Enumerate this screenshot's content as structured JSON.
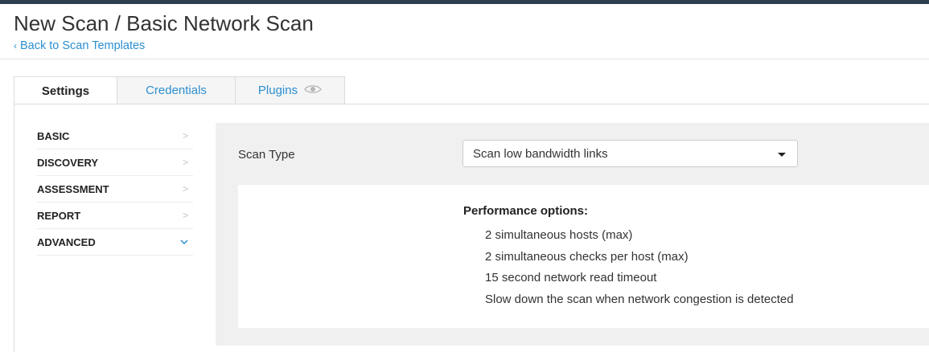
{
  "header": {
    "title": "New Scan / Basic Network Scan",
    "back_link": "Back to Scan Templates"
  },
  "tabs": [
    {
      "label": "Settings",
      "active": true
    },
    {
      "label": "Credentials",
      "active": false
    },
    {
      "label": "Plugins",
      "active": false,
      "icon": "eye-icon"
    }
  ],
  "sidebar": {
    "items": [
      {
        "label": "BASIC",
        "state": "collapsed"
      },
      {
        "label": "DISCOVERY",
        "state": "collapsed"
      },
      {
        "label": "ASSESSMENT",
        "state": "collapsed"
      },
      {
        "label": "REPORT",
        "state": "collapsed"
      },
      {
        "label": "ADVANCED",
        "state": "expanded"
      }
    ]
  },
  "main": {
    "scan_type_label": "Scan Type",
    "scan_type_value": "Scan low bandwidth links",
    "performance": {
      "title": "Performance options:",
      "options": [
        "2 simultaneous hosts (max)",
        "2 simultaneous checks per host (max)",
        "15 second network read timeout",
        "Slow down the scan when network congestion is detected"
      ]
    }
  },
  "colors": {
    "accent": "#2b8fd0",
    "topbar": "#2c3e50",
    "content_bg": "#f0f0f0"
  }
}
